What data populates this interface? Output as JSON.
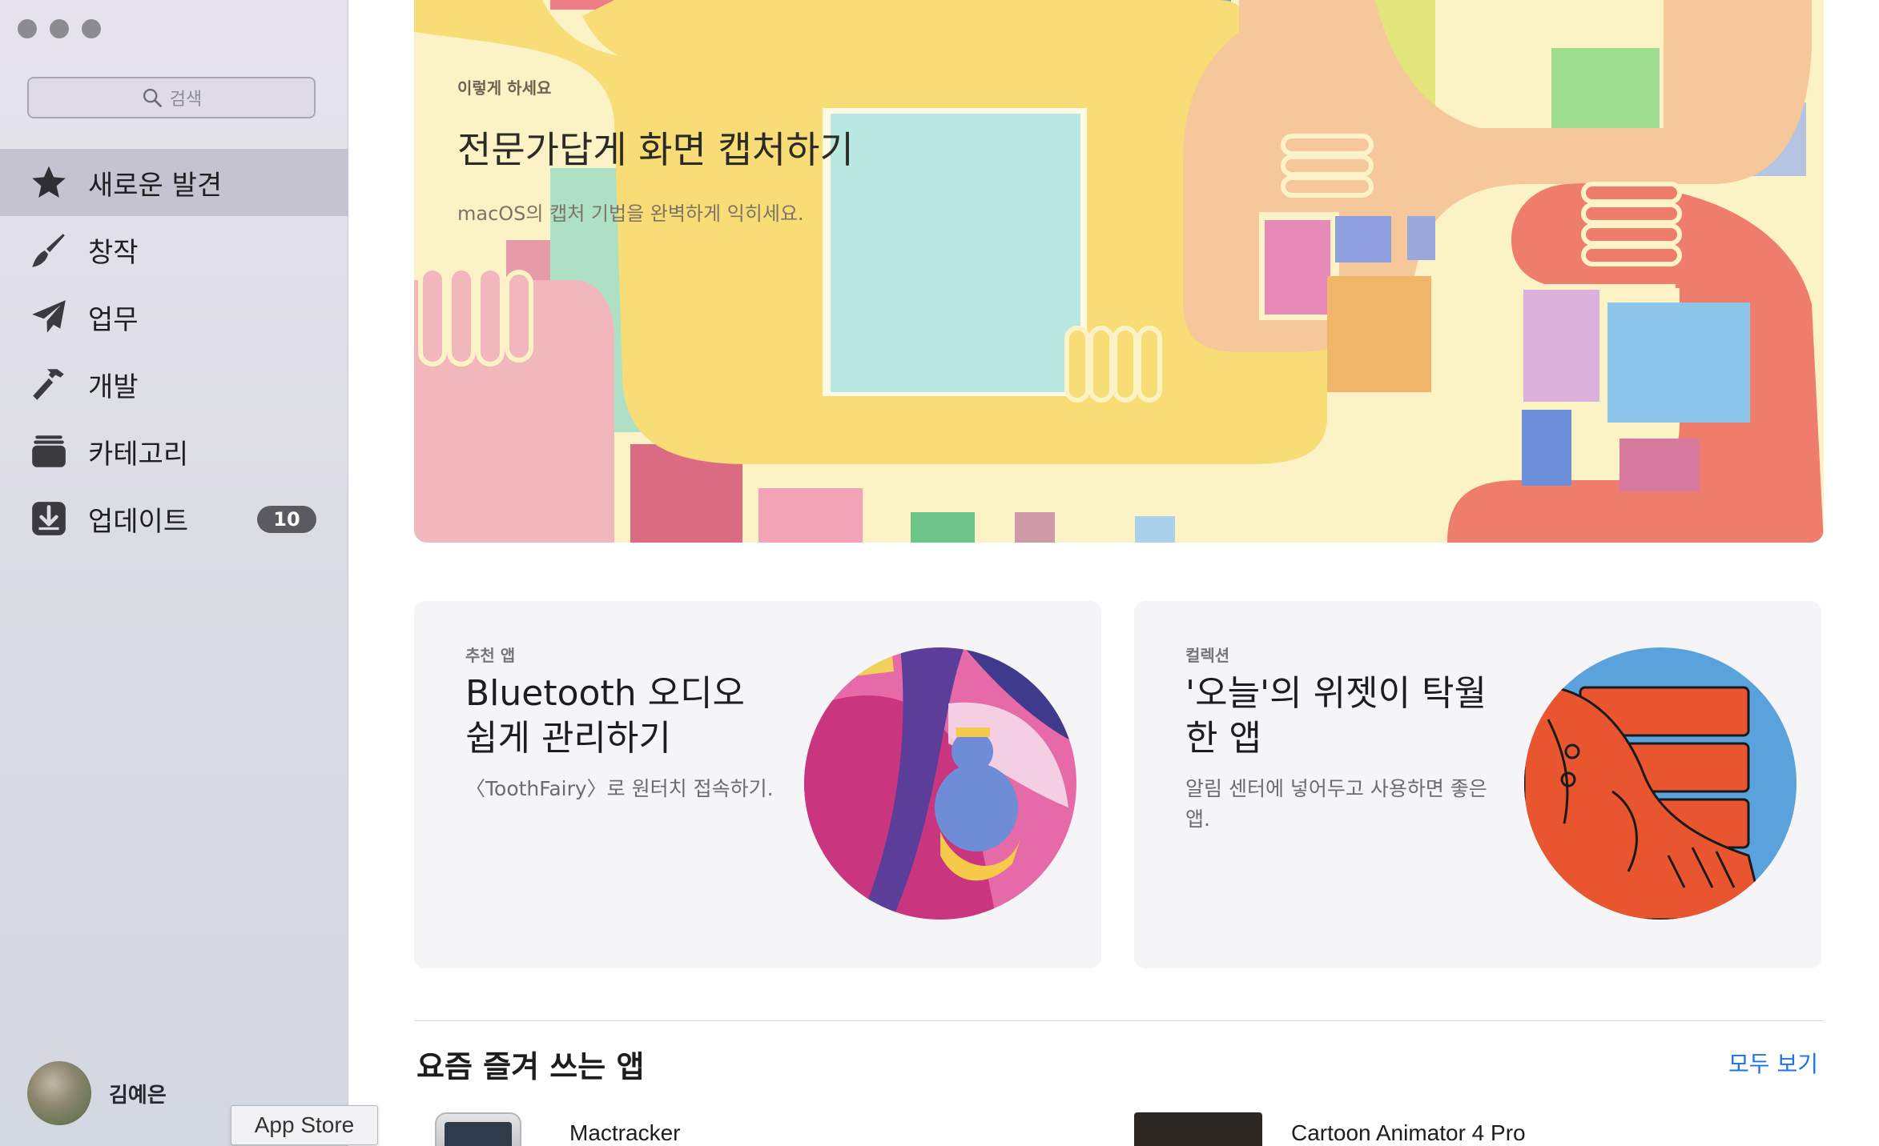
{
  "window": {
    "traffic_lights": [
      "close",
      "minimize",
      "zoom"
    ]
  },
  "sidebar": {
    "search": {
      "placeholder": "검색",
      "icon": "magnifying-glass-icon"
    },
    "items": [
      {
        "label": "새로운 발견",
        "icon": "star-icon",
        "active": true
      },
      {
        "label": "창작",
        "icon": "brush-icon"
      },
      {
        "label": "업무",
        "icon": "paper-plane-icon"
      },
      {
        "label": "개발",
        "icon": "hammer-icon"
      },
      {
        "label": "카테고리",
        "icon": "stack-icon"
      },
      {
        "label": "업데이트",
        "icon": "download-icon",
        "badge": "10"
      }
    ],
    "user": {
      "name": "김예은"
    },
    "tooltip": "App Store"
  },
  "hero": {
    "eyebrow": "이렇게 하세요",
    "title": "전문가답게 화면 캡처하기",
    "subtitle": "macOS의 캡처 기법을 완벽하게 익히세요."
  },
  "cards": [
    {
      "eyebrow": "추천 앱",
      "title": "Bluetooth 오디오 쉽게 관리하기",
      "description": "〈ToothFairy〉로 원터치 접속하기."
    },
    {
      "eyebrow": "컬렉션",
      "title": "'오늘'의 위젯이 탁월한 앱",
      "description": "알림 센터에 넣어두고 사용하면 좋은 앱."
    }
  ],
  "section": {
    "title": "요즘 즐겨 쓰는 앱",
    "see_all": "모두 보기",
    "apps": [
      {
        "name": "Mactracker"
      },
      {
        "name": "Cartoon Animator 4 Pro"
      }
    ]
  },
  "colors": {
    "accent": "#1a73e8",
    "sidebar_active": "#c5c3cf",
    "badge": "#5a5a60"
  }
}
